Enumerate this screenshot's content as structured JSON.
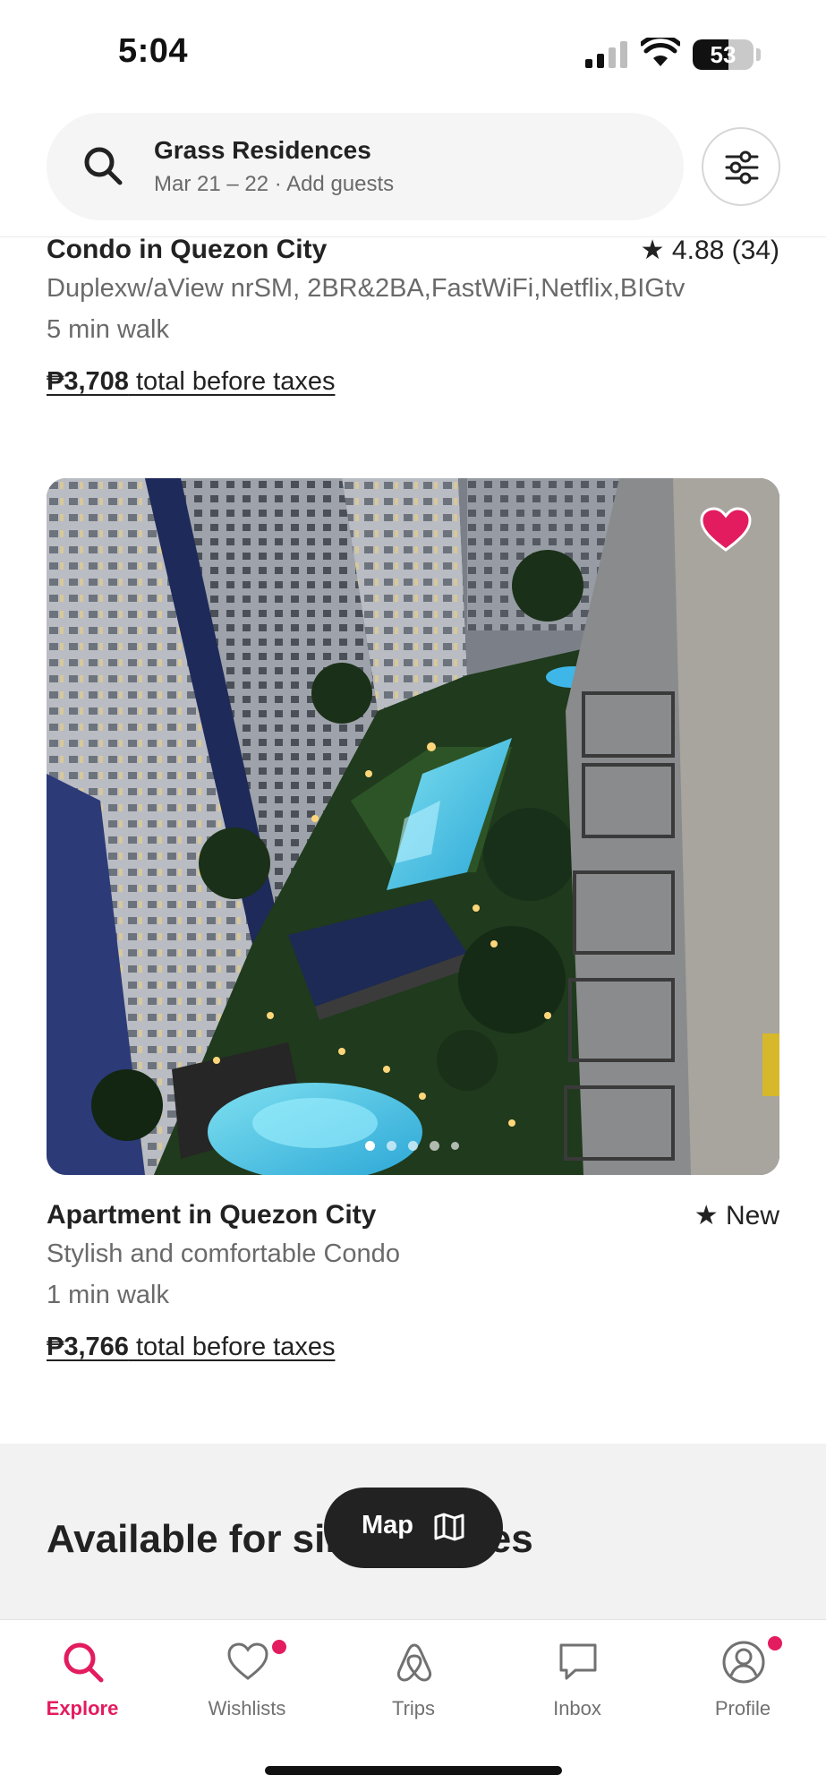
{
  "status_bar": {
    "time": "5:04",
    "battery_level": "53",
    "icons": [
      "signal-icon",
      "wifi-icon",
      "battery-icon"
    ]
  },
  "search": {
    "title": "Grass Residences",
    "subtitle": "Mar 21 – 22 · Add guests",
    "icons": [
      "search-icon",
      "filter-icon"
    ]
  },
  "listings": [
    {
      "title": "Condo in Quezon City",
      "rating": "4.88 (34)",
      "description": "Duplexw/aView nrSM, 2BR&2BA,FastWiFi,Netflix,BIGtv",
      "distance": "5 min walk",
      "price": "₱3,708",
      "price_suffix": " total before taxes"
    },
    {
      "title": "Apartment in Quezon City",
      "rating": "New",
      "description": "Stylish and comfortable Condo",
      "distance": "1 min walk",
      "price": "₱3,766",
      "price_suffix": " total before taxes",
      "photo_count": 5,
      "active_photo": 1,
      "wishlisted": true
    }
  ],
  "section": {
    "title": "Available for similar dates"
  },
  "map_button": {
    "label": "Map",
    "icon": "map-icon"
  },
  "nav": [
    {
      "label": "Explore",
      "icon": "search-icon",
      "active": true
    },
    {
      "label": "Wishlists",
      "icon": "heart-icon",
      "badge": true
    },
    {
      "label": "Trips",
      "icon": "airbnb-logo-icon"
    },
    {
      "label": "Inbox",
      "icon": "message-icon"
    },
    {
      "label": "Profile",
      "icon": "profile-icon",
      "badge": true
    }
  ],
  "colors": {
    "brand": "#e31c5f",
    "text": "#222222",
    "muted": "#6a6a6a"
  }
}
